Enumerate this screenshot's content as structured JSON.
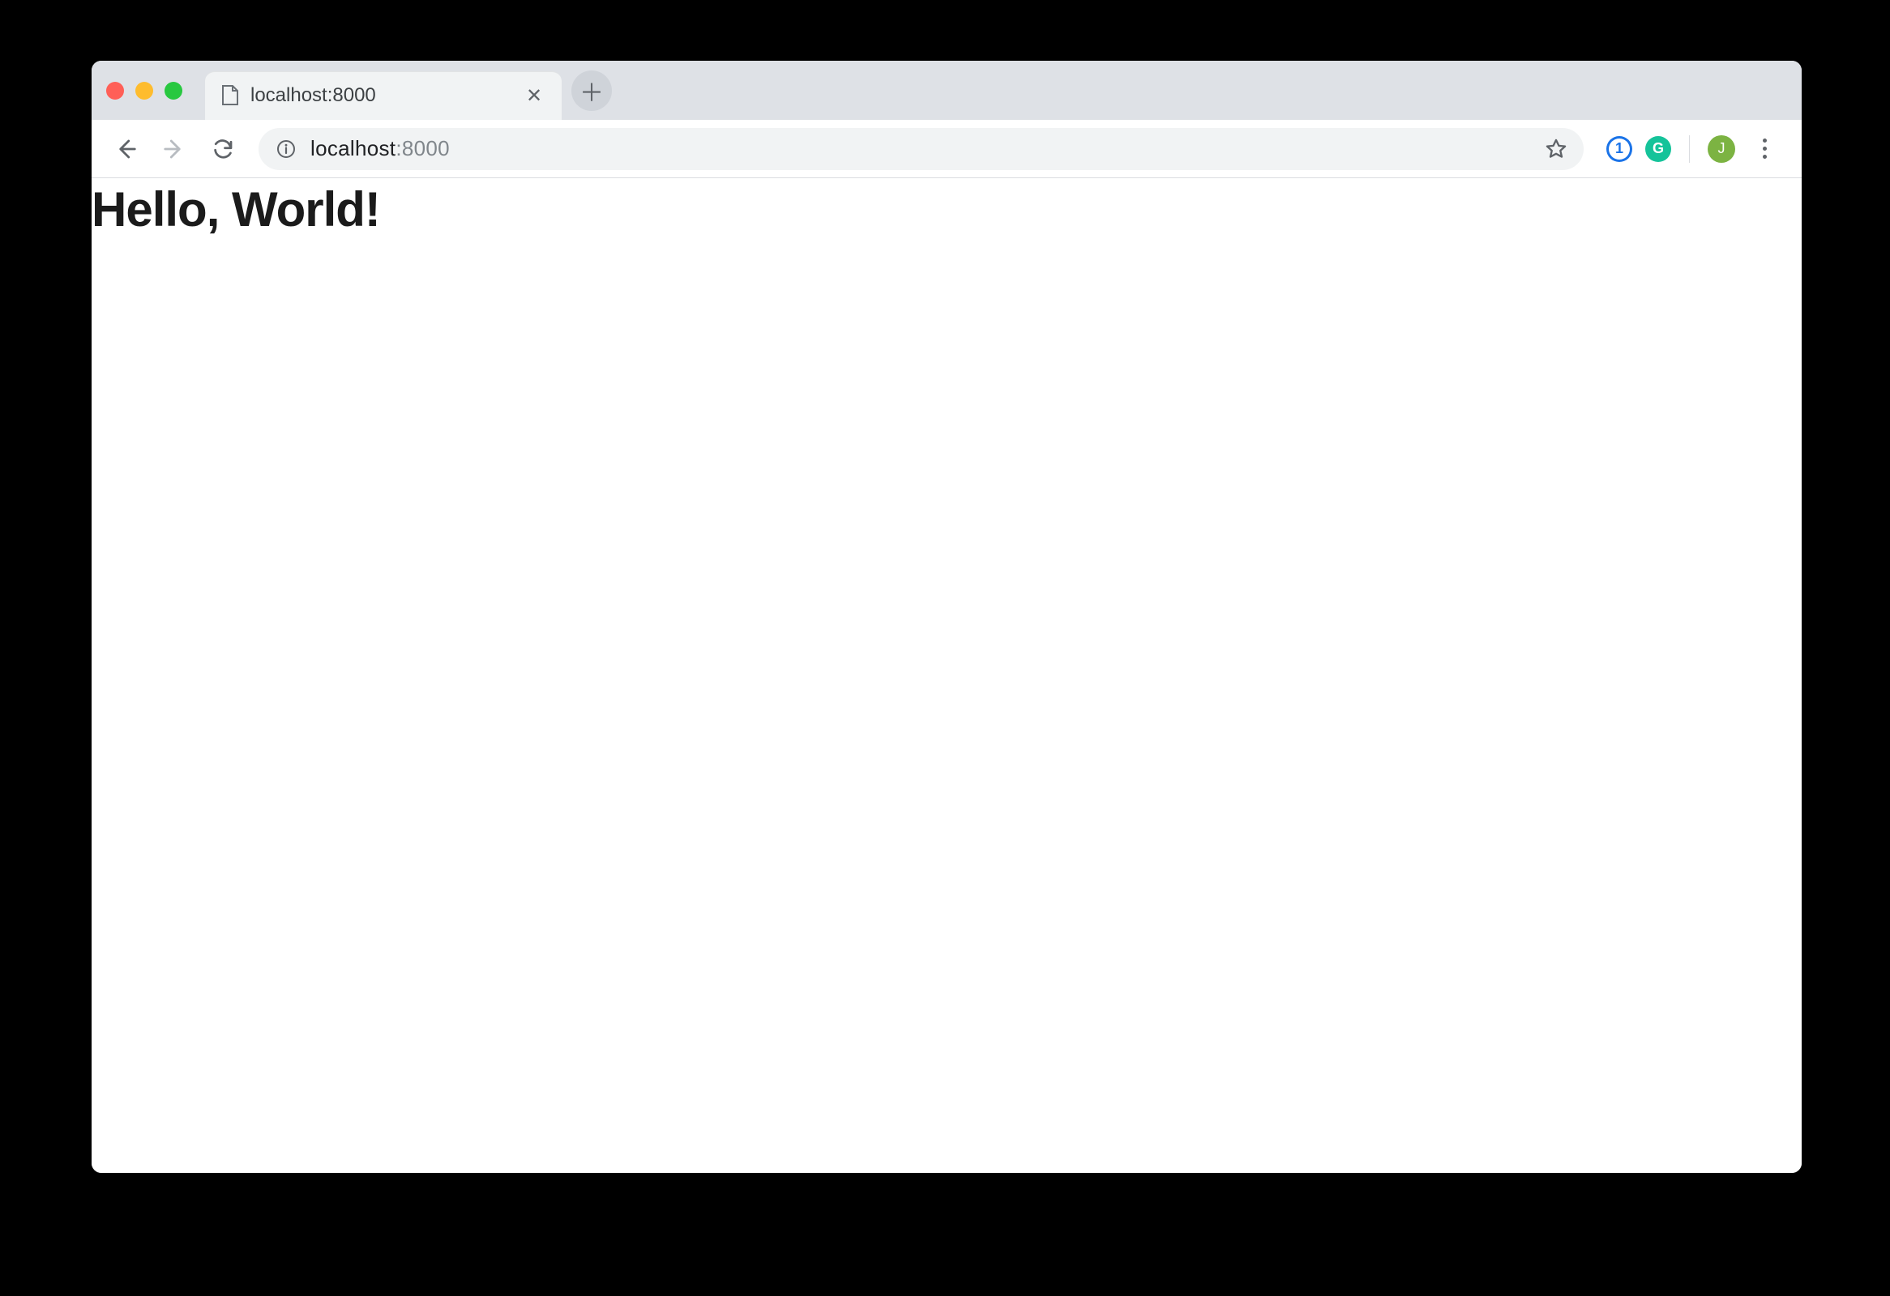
{
  "window": {
    "traffic_lights": {
      "close": "close",
      "minimize": "minimize",
      "maximize": "maximize"
    }
  },
  "tabs": {
    "active": {
      "title": "localhost:8000"
    }
  },
  "address_bar": {
    "url_host": "localhost",
    "url_port": ":8000"
  },
  "extensions": {
    "onepassword": "1",
    "grammarly": "G"
  },
  "profile": {
    "initial": "J"
  },
  "page": {
    "heading": "Hello, World!"
  }
}
